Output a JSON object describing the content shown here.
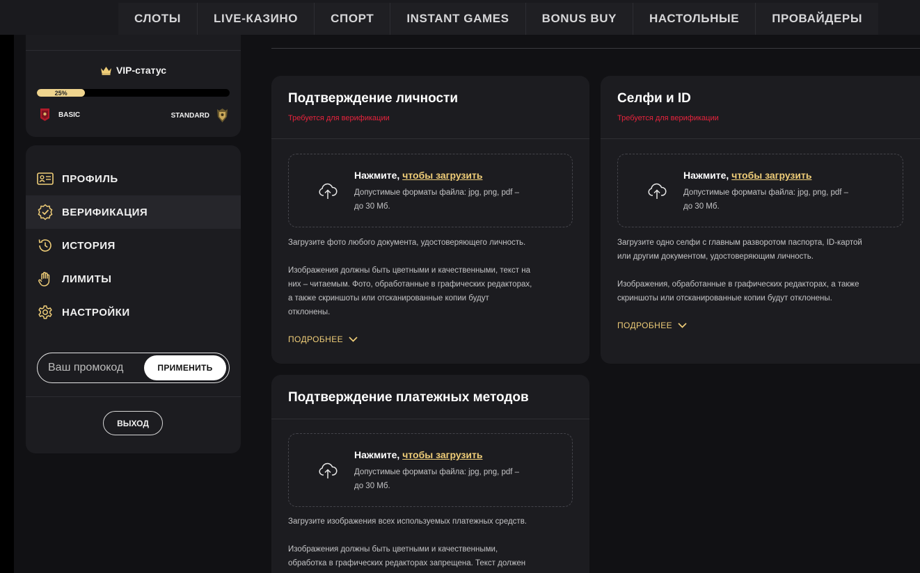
{
  "topnav": {
    "items": [
      "СЛОТЫ",
      "LIVE-КАЗИНО",
      "СПОРТ",
      "INSTANT GAMES",
      "BONUS BUY",
      "НАСТОЛЬНЫЕ",
      "ПРОВАЙДЕРЫ"
    ]
  },
  "vip": {
    "title": "VIP-статус",
    "progress_label": "25%",
    "progress_percent": 25,
    "current_level": "BASIC",
    "next_level": "STANDARD"
  },
  "menu": {
    "items": [
      {
        "label": "ПРОФИЛЬ",
        "icon": "id-card-icon"
      },
      {
        "label": "ВЕРИФИКАЦИЯ",
        "icon": "verified-badge-icon"
      },
      {
        "label": "ИСТОРИЯ",
        "icon": "history-icon"
      },
      {
        "label": "ЛИМИТЫ",
        "icon": "hand-icon"
      },
      {
        "label": "НАСТРОЙКИ",
        "icon": "gear-icon"
      }
    ],
    "active_index": 1,
    "promo_placeholder": "Ваш промокод",
    "promo_button": "ПРИМЕНИТЬ",
    "logout": "ВЫХОД"
  },
  "cards": {
    "identity": {
      "title": "Подтверждение личности",
      "subtitle": "Требуется для верификации",
      "upload_prefix": "Нажмите, ",
      "upload_link": "чтобы загрузить",
      "upload_desc_1": "Допустимые форматы файла: jpg, png, pdf –",
      "upload_desc_2": "до 30 Мб.",
      "text_1": "Загрузите фото любого документа, удостоверяющего личность.",
      "text_2_1": "Изображения должны быть цветными и качественными, текст на",
      "text_2_2": "них – читаемым. Фото, обработанные в графических редакторах,",
      "text_2_3": "а также скриншоты или отсканированные копии будут",
      "text_2_4": "отклонены.",
      "more": "ПОДРОБНЕЕ"
    },
    "selfie": {
      "title": "Селфи и ID",
      "subtitle": "Требуется для верификации",
      "upload_prefix": "Нажмите, ",
      "upload_link": "чтобы загрузить",
      "upload_desc_1": "Допустимые форматы файла: jpg, png, pdf –",
      "upload_desc_2": "до 30 Мб.",
      "text_1_1": "Загрузите одно селфи с главным разворотом паспорта, ID-картой",
      "text_1_2": "или другим документом, удостоверяющим личность.",
      "text_2_1": "Изображения, обработанные в графических редакторах, а также",
      "text_2_2": "скриншоты или отсканированные копии будут отклонены.",
      "more": "ПОДРОБНЕЕ"
    },
    "payment": {
      "title": "Подтверждение платежных методов",
      "upload_prefix": "Нажмите, ",
      "upload_link": "чтобы загрузить",
      "upload_desc_1": "Допустимые форматы файла: jpg, png, pdf –",
      "upload_desc_2": "до 30 Мб.",
      "text_1": "Загрузите изображения всех используемых платежных средств.",
      "text_2_1": "Изображения должны быть цветными и качественными,",
      "text_2_2": "обработка в графических редакторах запрещена. Текст должен"
    }
  },
  "colors": {
    "accent_gold": "#efcd78",
    "required_red": "#e8233d",
    "card_bg": "#1c1c20",
    "page_bg": "#111114"
  }
}
